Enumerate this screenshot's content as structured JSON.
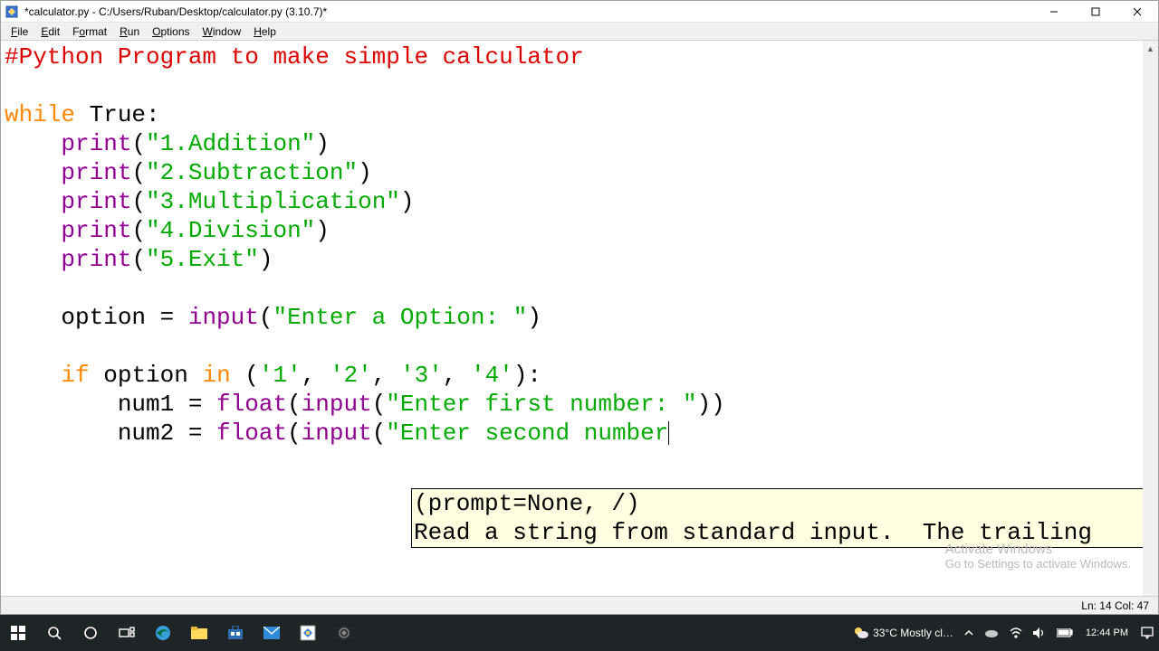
{
  "titlebar": {
    "title": "*calculator.py - C:/Users/Ruban/Desktop/calculator.py (3.10.7)*"
  },
  "menus": {
    "file": "File",
    "edit": "Edit",
    "format": "Format",
    "run": "Run",
    "options": "Options",
    "window": "Window",
    "help": "Help"
  },
  "code": {
    "l1": "#Python Program to make simple calculator",
    "l3_kw": "while",
    "l3_rest": " True:",
    "indent1": "    ",
    "indent2": "        ",
    "print": "print",
    "input": "input",
    "float": "float",
    "lp": "(",
    "rp": ")",
    "s_add": "\"1.Addition\"",
    "s_sub": "\"2.Subtraction\"",
    "s_mul": "\"3.Multiplication\"",
    "s_div": "\"4.Division\"",
    "s_exit": "\"5.Exit\"",
    "opt_lhs": "    option = ",
    "s_opt": "\"Enter a Option: \"",
    "if_kw": "if",
    "if_mid": " option ",
    "in_kw": "in",
    "if_tuple_open": " (",
    "s1": "'1'",
    "s2": "'2'",
    "s3": "'3'",
    "s4": "'4'",
    "comma": ", ",
    "if_close": "):",
    "num1_lhs": "        num1 = ",
    "num2_lhs": "        num2 = ",
    "s_first": "\"Enter first number: \"",
    "s_second": "\"Enter second number",
    "rp2": "))"
  },
  "tooltip": {
    "l1": "(prompt=None, /)",
    "l2": "Read a string from standard input.  The trailing"
  },
  "watermark": {
    "l1": "Activate Windows",
    "l2": "Go to Settings to activate Windows."
  },
  "statusbar": {
    "pos": "Ln: 14   Col: 47"
  },
  "taskbar": {
    "weather": "33°C  Mostly cl…",
    "time": "12:44 PM"
  }
}
